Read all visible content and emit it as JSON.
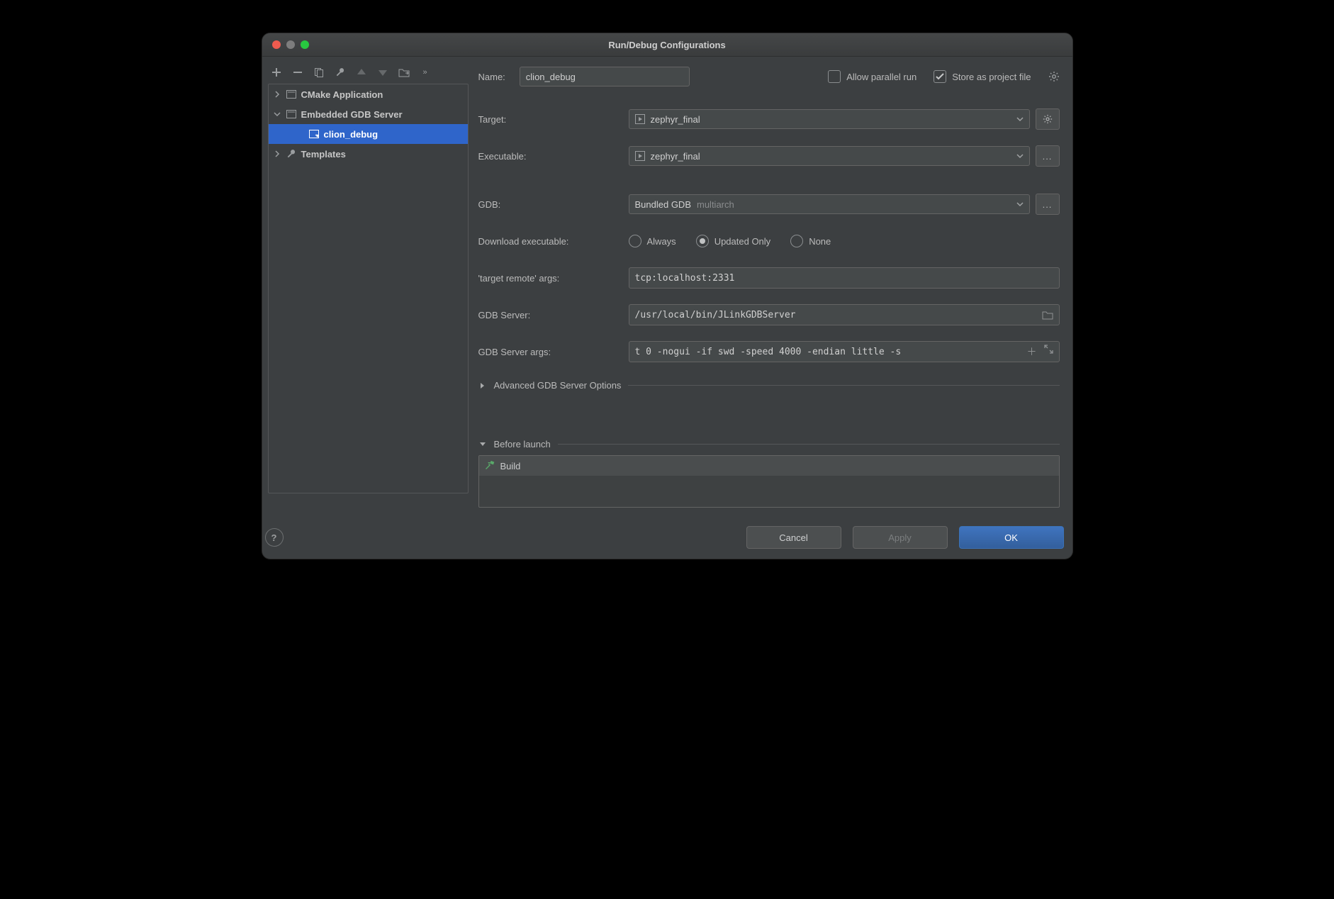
{
  "window": {
    "title": "Run/Debug Configurations"
  },
  "toolbar_icons": [
    "add",
    "remove",
    "copy",
    "edit",
    "up",
    "down",
    "folder-move",
    "more"
  ],
  "tree": {
    "items": [
      {
        "icon": "chevron-right",
        "kind": "app",
        "label": "CMake Application"
      },
      {
        "icon": "chevron-down",
        "kind": "app",
        "label": "Embedded GDB Server"
      },
      {
        "icon": "run",
        "label": "clion_debug",
        "selected": true
      },
      {
        "icon": "chevron-right",
        "kind": "wrench",
        "label": "Templates"
      }
    ]
  },
  "form": {
    "name_label": "Name:",
    "name_value": "clion_debug",
    "allow_parallel_label": "Allow parallel run",
    "allow_parallel_checked": false,
    "store_label": "Store as project file",
    "store_checked": true,
    "target_label": "Target:",
    "target_value": "zephyr_final",
    "executable_label": "Executable:",
    "executable_value": "zephyr_final",
    "gdb_label": "GDB:",
    "gdb_value": "Bundled GDB",
    "gdb_suffix": "multiarch",
    "download_label": "Download executable:",
    "download_options": [
      "Always",
      "Updated Only",
      "None"
    ],
    "download_selected": "Updated Only",
    "remote_label": "'target remote' args:",
    "remote_value": "tcp:localhost:2331",
    "gdbserver_label": "GDB Server:",
    "gdbserver_value": "/usr/local/bin/JLinkGDBServer",
    "gdbargs_label": "GDB Server args:",
    "gdbargs_value": "t 0 -nogui -if swd -speed 4000 -endian little -s",
    "advanced_label": "Advanced GDB Server Options",
    "before_label": "Before launch",
    "before_item": "Build"
  },
  "footer": {
    "cancel": "Cancel",
    "apply": "Apply",
    "ok": "OK"
  }
}
